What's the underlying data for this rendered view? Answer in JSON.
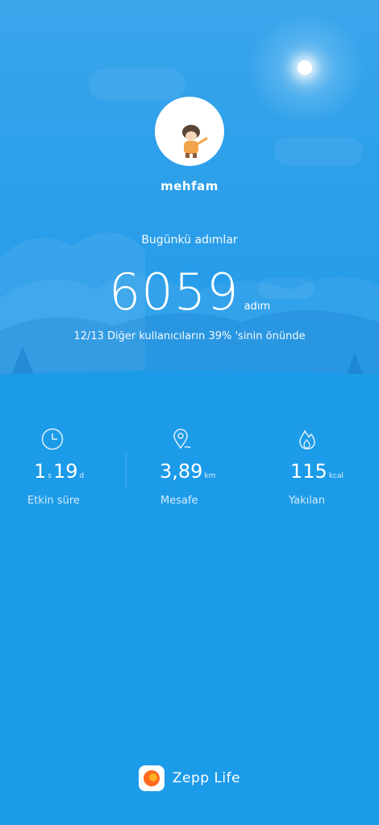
{
  "profile": {
    "username": "mehfam"
  },
  "steps": {
    "label": "Bugünkü adımlar",
    "count": "6059",
    "unit": "adım",
    "rank_text": "12/13 Diğer kullanıcıların 39% 'sinin önünde"
  },
  "stats": [
    {
      "icon": "clock-icon",
      "value_main": "1",
      "value_sub": "s",
      "value_main2": "19",
      "value_sub2": "d",
      "label": "Etkin süre"
    },
    {
      "icon": "location-pin-icon",
      "value_main": "3,89",
      "value_sub": "km",
      "label": "Mesafe"
    },
    {
      "icon": "flame-icon",
      "value_main": "115",
      "value_sub": "kcal",
      "label": "Yakılan"
    }
  ],
  "brand": {
    "name": "Zepp Life"
  },
  "colors": {
    "background": "#1c9be9",
    "logo_orange": "#ff6a1f"
  }
}
